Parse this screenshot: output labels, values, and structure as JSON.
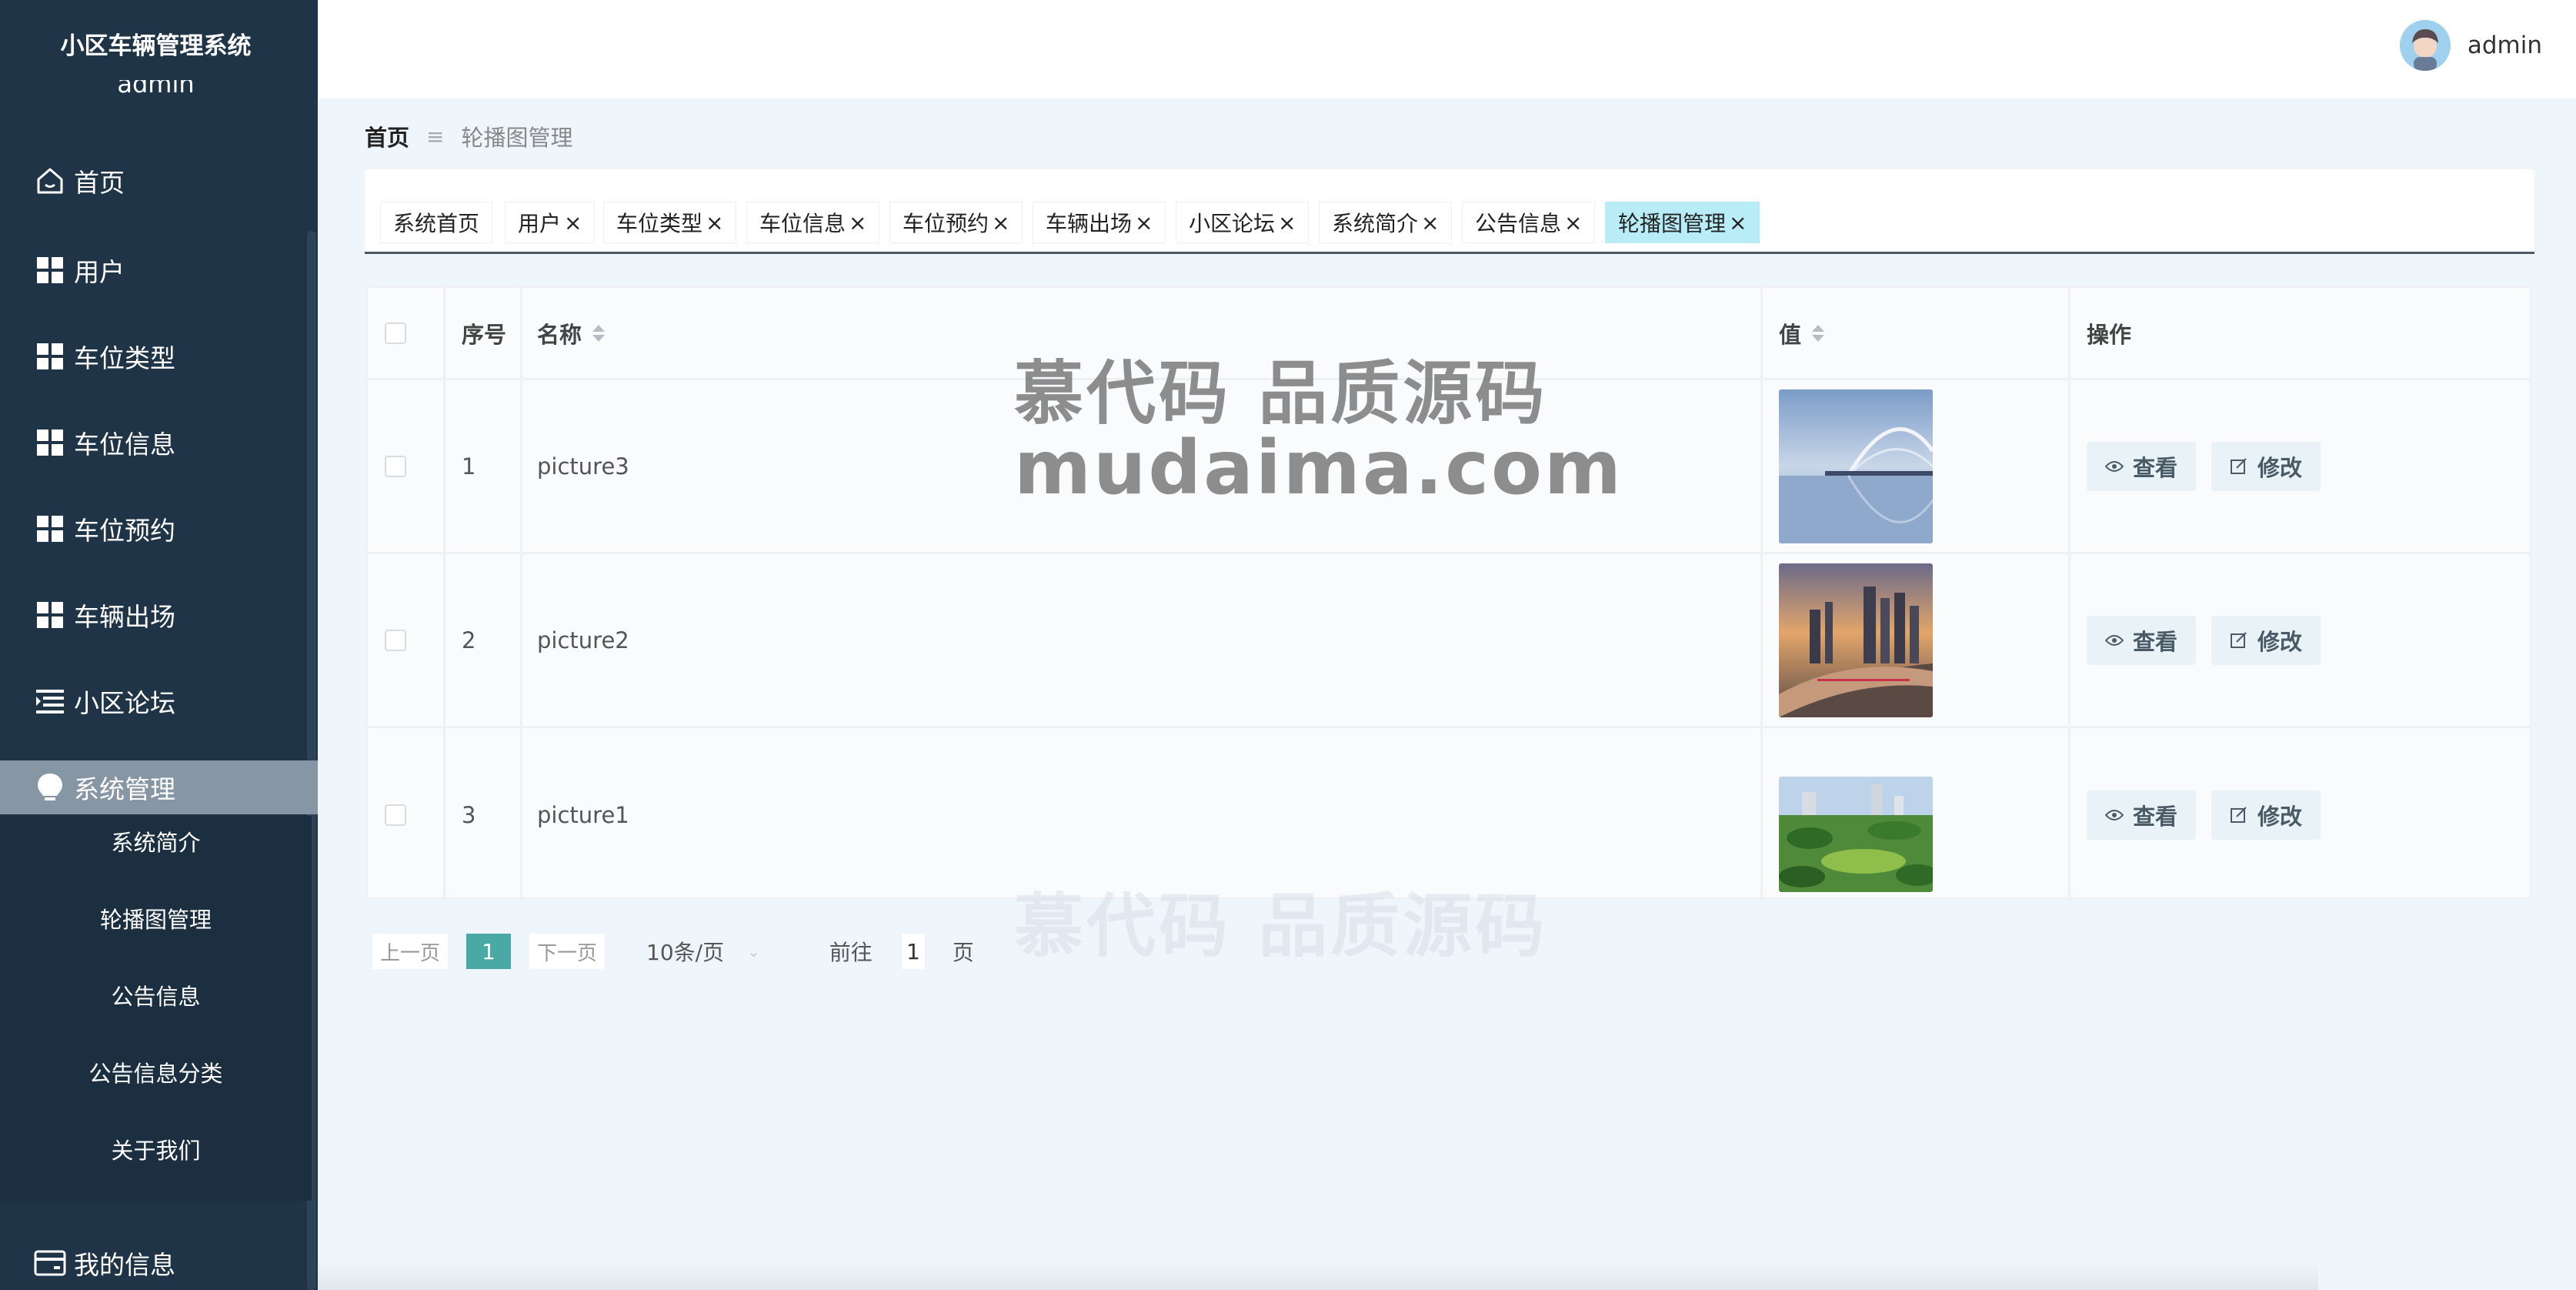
{
  "sidebar": {
    "title": "小区车辆管理系统",
    "user": "admin",
    "items": [
      {
        "label": "首页"
      },
      {
        "label": "用户"
      },
      {
        "label": "车位类型"
      },
      {
        "label": "车位信息"
      },
      {
        "label": "车位预约"
      },
      {
        "label": "车辆出场"
      },
      {
        "label": "小区论坛"
      },
      {
        "label": "系统管理"
      }
    ],
    "sub_items": [
      {
        "label": "系统简介"
      },
      {
        "label": "轮播图管理"
      },
      {
        "label": "公告信息"
      },
      {
        "label": "公告信息分类"
      },
      {
        "label": "关于我们"
      }
    ],
    "my_info": "我的信息"
  },
  "header": {
    "username": "admin"
  },
  "breadcrumb": {
    "home": "首页",
    "current": "轮播图管理"
  },
  "tags": [
    {
      "label": "系统首页",
      "closable": false
    },
    {
      "label": "用户",
      "closable": true
    },
    {
      "label": "车位类型",
      "closable": true
    },
    {
      "label": "车位信息",
      "closable": true
    },
    {
      "label": "车位预约",
      "closable": true
    },
    {
      "label": "车辆出场",
      "closable": true
    },
    {
      "label": "小区论坛",
      "closable": true
    },
    {
      "label": "系统简介",
      "closable": true
    },
    {
      "label": "公告信息",
      "closable": true
    },
    {
      "label": "轮播图管理",
      "closable": true,
      "active": true
    }
  ],
  "close_glyph": "×",
  "table": {
    "columns": {
      "index": "序号",
      "name": "名称",
      "value": "值",
      "actions": "操作"
    },
    "rows": [
      {
        "index": "1",
        "name": "picture3",
        "image": "bridge-lake-photo"
      },
      {
        "index": "2",
        "name": "picture2",
        "image": "city-river-sunset-photo"
      },
      {
        "index": "3",
        "name": "picture1",
        "image": "park-skyline-photo"
      }
    ],
    "view_label": "查看",
    "edit_label": "修改"
  },
  "pagination": {
    "prev": "上一页",
    "current_page": "1",
    "next": "下一页",
    "page_size": "10条/页",
    "goto": "前往",
    "goto_value": "1",
    "unit": "页"
  },
  "watermark": {
    "line1": "慕代码 品质源码",
    "line2": "mudaima.com"
  },
  "colors": {
    "sidebar": "#1f3446",
    "active_nav": "#8796a4",
    "active_tag": "#b8ecf6",
    "pager_active": "#4aa9a4"
  }
}
